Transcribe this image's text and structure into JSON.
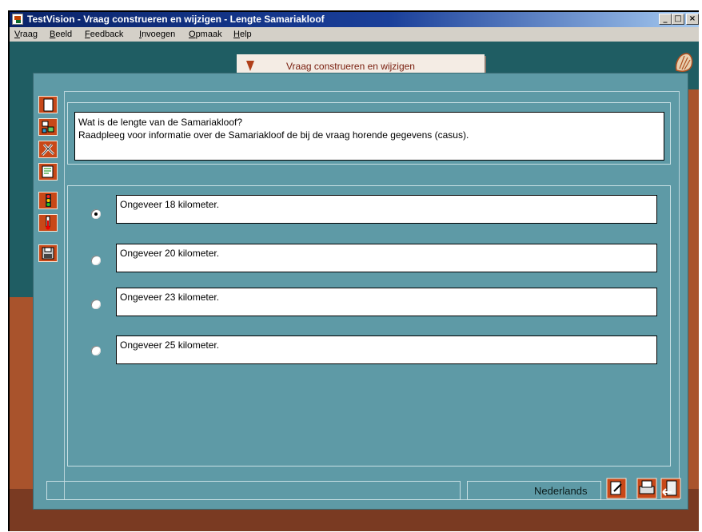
{
  "window": {
    "title": "TestVision - Vraag construeren en wijzigen - Lengte Samariakloof",
    "controls": {
      "minimize": "_",
      "maximize": "□",
      "close": "×"
    }
  },
  "menu": {
    "items": [
      {
        "label": "Vraag",
        "accel": "V",
        "rest": "raag"
      },
      {
        "label": "Beeld",
        "accel": "B",
        "rest": "eeld"
      },
      {
        "label": "Feedback",
        "accel": "F",
        "rest": "eedback"
      },
      {
        "label": "Invoegen",
        "accel": "I",
        "rest": "nvoegen"
      },
      {
        "label": "Opmaak",
        "accel": "O",
        "rest": "pmaak"
      },
      {
        "label": "Help",
        "accel": "H",
        "rest": "elp"
      }
    ]
  },
  "banner": {
    "title": "Vraag construeren en wijzigen"
  },
  "question": {
    "line1": "Wat is de lengte van de Samariakloof?",
    "line2": "Raadpleeg voor informatie over de Samariakloof de bij de vraag horende gegevens (casus)."
  },
  "answers": [
    {
      "text": "Ongeveer 18 kilometer.",
      "selected": true
    },
    {
      "text": "Ongeveer 20 kilometer.",
      "selected": false
    },
    {
      "text": "Ongeveer 23 kilometer.",
      "selected": false
    },
    {
      "text": "Ongeveer 25 kilometer.",
      "selected": false
    }
  ],
  "toolbar": {
    "icons": [
      "new-document-icon",
      "structure-icon",
      "tools-icon",
      "list-edit-icon",
      "traffic-light-icon",
      "thermometer-icon",
      "save-disk-icon"
    ]
  },
  "status": {
    "language": "Nederlands",
    "icons": [
      "edit-document-icon",
      "print-icon",
      "exit-icon"
    ]
  },
  "colors": {
    "titlebar": "#0a246a",
    "panel": "#5e9aa6",
    "tool_accent": "#c84818",
    "banner_text": "#7a2010"
  }
}
